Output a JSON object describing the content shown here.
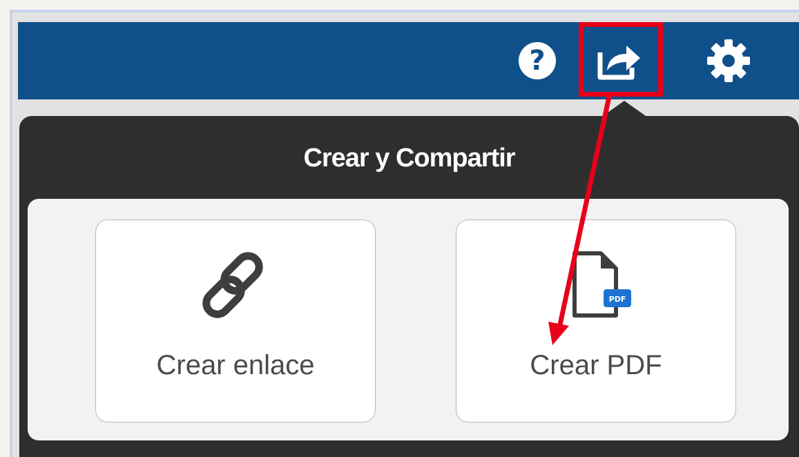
{
  "toolbar": {
    "icons": [
      "question-circle-icon",
      "share-export-icon",
      "gear-icon"
    ],
    "help_glyph": "?",
    "background": "#10508a"
  },
  "popover": {
    "title": "Crear y Compartir",
    "options": [
      {
        "label": "Crear enlace",
        "icon": "link-chain-icon"
      },
      {
        "label": "Crear PDF",
        "icon": "pdf-file-icon",
        "badge": "PDF"
      }
    ]
  },
  "annotation": {
    "highlight_color": "#e8001a",
    "badge_color": "#1e73d2"
  }
}
